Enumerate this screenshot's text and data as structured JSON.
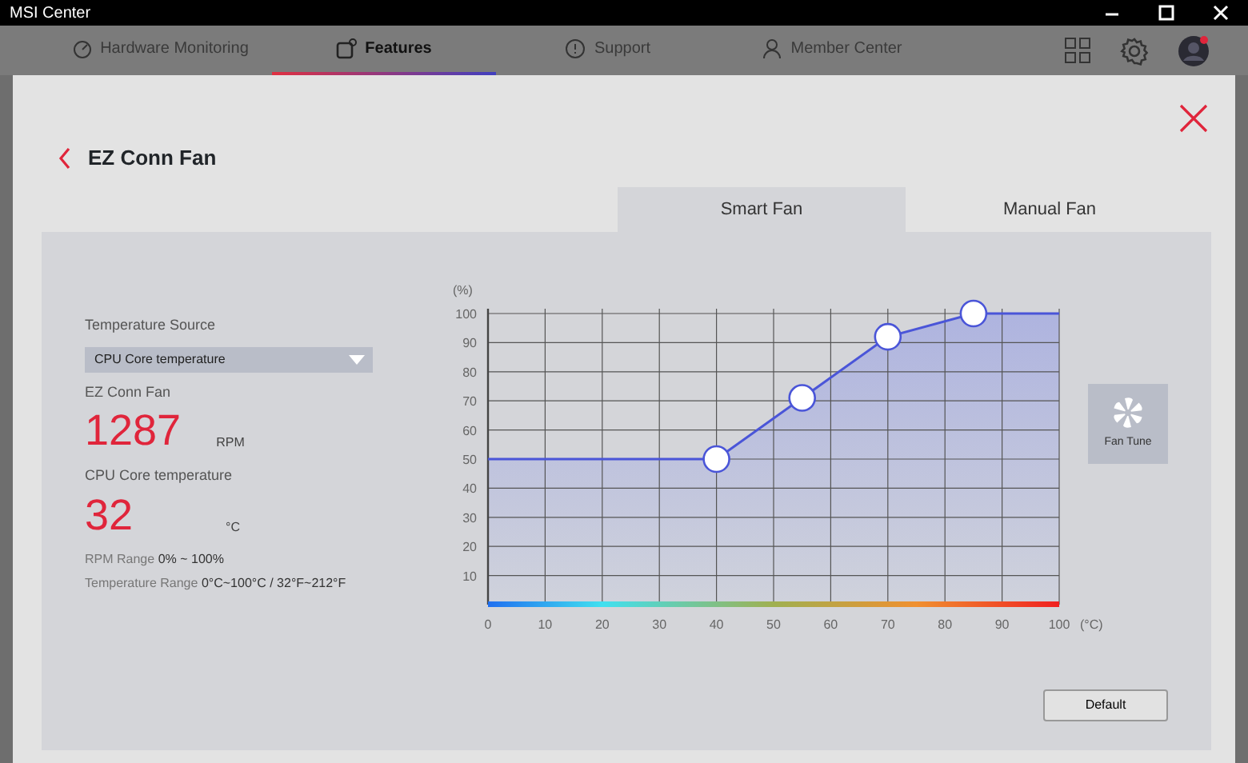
{
  "window": {
    "title": "MSI Center"
  },
  "nav_tabs": [
    {
      "label": "Hardware Monitoring",
      "selected": false
    },
    {
      "label": "Features",
      "selected": true
    },
    {
      "label": "Support",
      "selected": false
    },
    {
      "label": "Member Center",
      "selected": false
    }
  ],
  "header": {
    "title": "EZ Conn Fan"
  },
  "mode_tabs": [
    {
      "label": "Smart Fan",
      "selected": true
    },
    {
      "label": "Manual Fan",
      "selected": false
    }
  ],
  "temperature_source": {
    "label": "Temperature Source",
    "value": "CPU Core temperature"
  },
  "fan": {
    "label": "EZ Conn Fan",
    "value": "1287",
    "unit": "RPM"
  },
  "temperature": {
    "label": "CPU Core temperature",
    "value": "32",
    "unit": "°C"
  },
  "ranges": [
    {
      "label": "RPM Range",
      "value": "0% ~ 100%"
    },
    {
      "label": "Temperature Range",
      "value": "0°C~100°C / 32°F~212°F"
    }
  ],
  "chart": {
    "chart_data": {
      "type": "area",
      "xlabel": "(°C)",
      "ylabel": "(%)",
      "x": [
        0,
        40,
        55,
        70,
        85,
        100
      ],
      "series": [
        {
          "color": "#4a55d8",
          "values": [
            50,
            50,
            71,
            92,
            100,
            100
          ]
        }
      ],
      "xlim": [
        0,
        100
      ],
      "ylim": [
        0,
        100
      ],
      "xticks": [
        0,
        10,
        20,
        30,
        40,
        50,
        60,
        70,
        80,
        90,
        100
      ],
      "yticks": [
        10,
        20,
        30,
        40,
        50,
        60,
        70,
        80,
        90,
        100
      ],
      "grid": true
    }
  },
  "fan_tune": {
    "label": "Fan Tune"
  },
  "default_button": {
    "label": "Default"
  }
}
